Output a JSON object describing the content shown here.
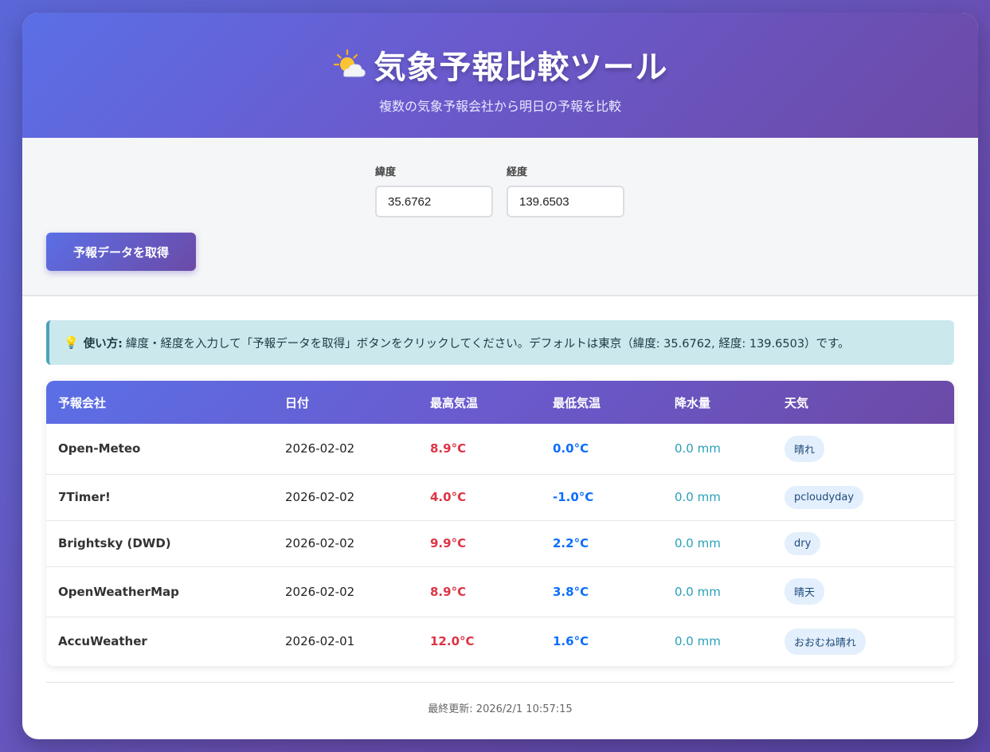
{
  "header": {
    "title": "気象予報比較ツール",
    "title_icon": "sun-behind-cloud-icon",
    "subtitle": "複数の気象予報会社から明日の予報を比較"
  },
  "controls": {
    "latitude_label": "緯度",
    "latitude_value": "35.6762",
    "longitude_label": "経度",
    "longitude_value": "139.6503",
    "fetch_button": "予報データを取得"
  },
  "info": {
    "icon": "lightbulb-icon",
    "lead": "使い方:",
    "text": "緯度・経度を入力して「予報データを取得」ボタンをクリックしてください。デフォルトは東京（緯度: 35.6762, 経度: 139.6503）です。"
  },
  "table": {
    "headers": [
      "予報会社",
      "日付",
      "最高気温",
      "最低気温",
      "降水量",
      "天気"
    ],
    "rows": [
      {
        "company": "Open-Meteo",
        "date": "2026-02-02",
        "max": "8.9°C",
        "min": "0.0°C",
        "precip": "0.0 mm",
        "weather": "晴れ"
      },
      {
        "company": "7Timer!",
        "date": "2026-02-02",
        "max": "4.0°C",
        "min": "-1.0°C",
        "precip": "0.0 mm",
        "weather": "pcloudyday"
      },
      {
        "company": "Brightsky (DWD)",
        "date": "2026-02-02",
        "max": "9.9°C",
        "min": "2.2°C",
        "precip": "0.0 mm",
        "weather": "dry"
      },
      {
        "company": "OpenWeatherMap",
        "date": "2026-02-02",
        "max": "8.9°C",
        "min": "3.8°C",
        "precip": "0.0 mm",
        "weather": "晴天"
      },
      {
        "company": "AccuWeather",
        "date": "2026-02-01",
        "max": "12.0°C",
        "min": "1.6°C",
        "precip": "0.0 mm",
        "weather": "おおむね晴れ"
      }
    ]
  },
  "footer": {
    "last_updated": "最終更新: 2026/2/1 10:57:15"
  },
  "colors": {
    "max_temp": "#dc3545",
    "min_temp": "#0d6efd",
    "precip": "#2aa0b8",
    "accent_start": "#5b6fe6",
    "accent_end": "#6c4aa6"
  }
}
